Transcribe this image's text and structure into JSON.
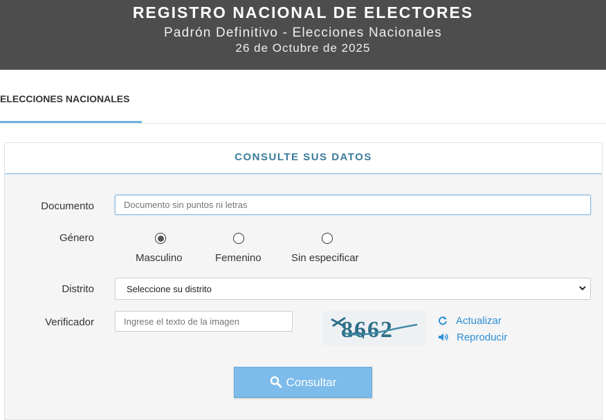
{
  "header": {
    "title": "REGISTRO NACIONAL DE ELECTORES",
    "subtitle": "Padrón Definitivo - Elecciones Nacionales",
    "date": "26 de Octubre de 2025"
  },
  "tabs": [
    {
      "label": "ELECCIONES NACIONALES",
      "active": true
    }
  ],
  "panel": {
    "title": "CONSULTE SUS DATOS"
  },
  "form": {
    "documento": {
      "label": "Documento",
      "placeholder": "Documento sin puntos ni letras",
      "value": ""
    },
    "genero": {
      "label": "Género",
      "options": [
        {
          "label": "Masculino",
          "selected": true
        },
        {
          "label": "Femenino",
          "selected": false
        },
        {
          "label": "Sin especificar",
          "selected": false
        }
      ]
    },
    "distrito": {
      "label": "Distrito",
      "selected": "Seleccione su distrito"
    },
    "verificador": {
      "label": "Verificador",
      "placeholder": "Ingrese el texto de la imagen",
      "captcha_text": "8662",
      "refresh_label": "Actualizar",
      "audio_label": "Reproducir"
    },
    "submit_label": "Consultar"
  },
  "colors": {
    "banner": "#4d4d4d",
    "accent": "#6fb1e0",
    "panel_title": "#3a7b9c",
    "link": "#2b8fd6",
    "button": "#7cbbea"
  },
  "icons": {
    "submit": "search-icon",
    "refresh": "refresh-icon",
    "audio": "volume-icon",
    "select": "chevron-down-icon"
  }
}
